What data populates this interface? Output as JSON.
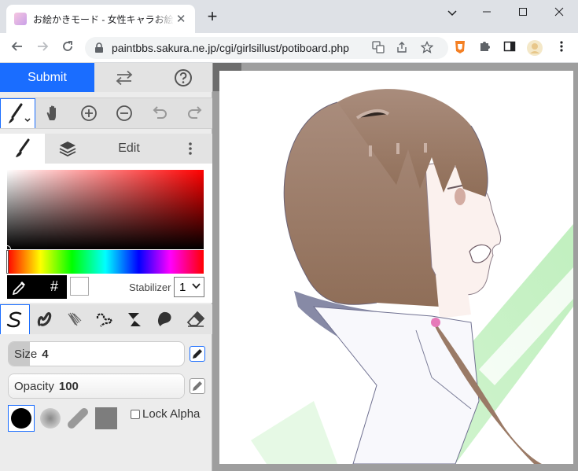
{
  "browser": {
    "tab_title": "お絵かきモード - 女性キャラお絵かき掲示板",
    "new_tab": "+",
    "url": "paintbbs.sakura.ne.jp/cgi/girlsillust/potiboard.php"
  },
  "app": {
    "submit_label": "Submit",
    "edit_tab_label": "Edit",
    "hex_symbol": "#",
    "stabilizer_label": "Stabilizer",
    "stabilizer_value": "1",
    "size_label": "Size",
    "size_value": "4",
    "size_fill": 0.12,
    "opacity_label": "Opacity",
    "opacity_value": "100",
    "opacity_fill": 1.0,
    "lock_alpha_label": "Lock Alpha",
    "current_color": "#000000",
    "accent_color": "#1a6dff"
  }
}
